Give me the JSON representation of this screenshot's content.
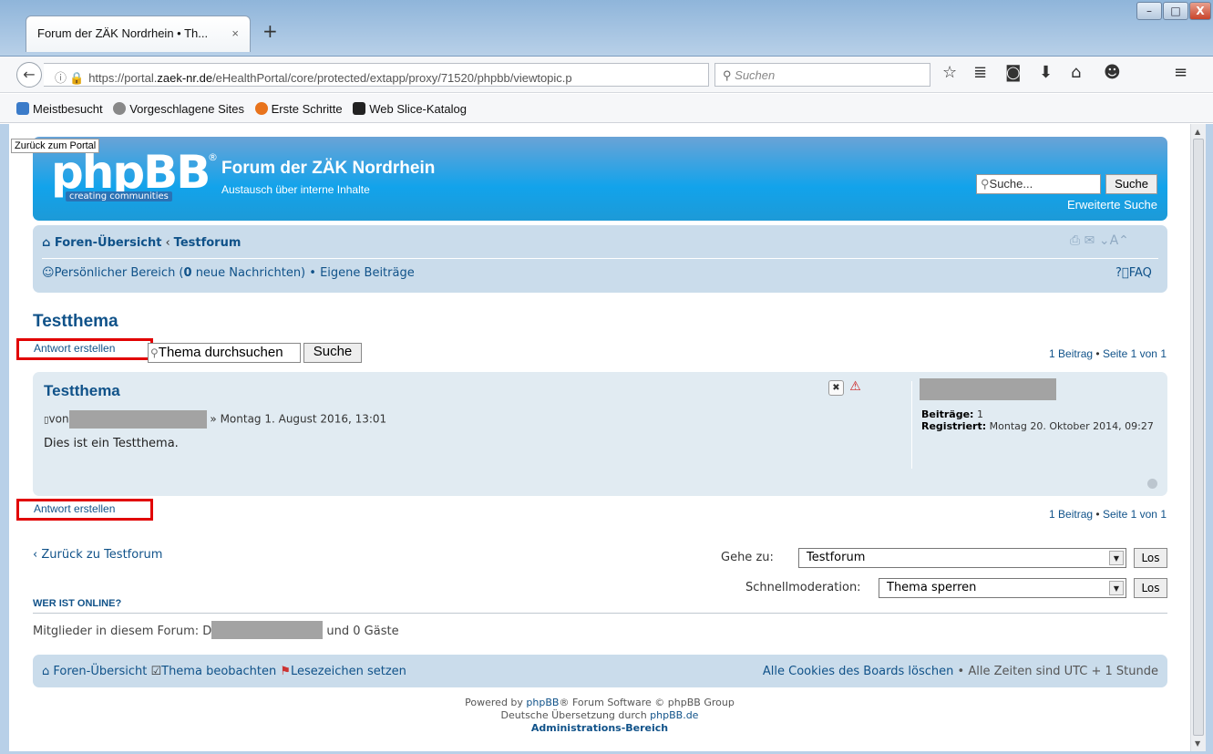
{
  "browser": {
    "tab_title": "Forum der ZÄK Nordrhein • Th...",
    "tab_close": "×",
    "new_tab": "+",
    "win_min": "–",
    "win_max": "□",
    "win_close": "X",
    "url_prefix": "https://portal.",
    "url_domain": "zaek-nr.de",
    "url_path": "/eHealthPortal/core/protected/extapp/proxy/71520/phpbb/viewtopic.p",
    "search_placeholder": "Suchen",
    "toolbar_icons": [
      "star-icon",
      "bookmarks-list-icon",
      "pocket-icon",
      "download-icon",
      "home-icon",
      "chat-icon",
      "menu-icon"
    ],
    "bookmarks": [
      "Meistbesucht",
      "Vorgeschlagene Sites",
      "Erste Schritte",
      "Web Slice-Katalog"
    ]
  },
  "page": {
    "portal_link": "Zurück zum Portal",
    "header": {
      "logo_text": "phpBB",
      "logo_tagline": "creating  communities",
      "title": "Forum der ZÄK Nordrhein",
      "description": "Austausch über interne Inhalte",
      "search_placeholder": "Suche...",
      "search_button": "Suche",
      "advanced_search": "Erweiterte Suche"
    },
    "nav": {
      "home": "Foren-Übersicht",
      "forum": "Testforum",
      "user_area_prefix": "Persönlicher Bereich (",
      "new_messages_count": "0",
      "user_area_suffix": " neue Nachrichten)",
      "own_posts": "Eigene Beiträge",
      "faq": "FAQ"
    },
    "topic": {
      "title": "Testthema",
      "reply_button": "Antwort erstellen",
      "search_placeholder": "Thema durchsuchen",
      "search_button": "Suche",
      "pagination_count": "1 Beitrag",
      "pagination_page": "Seite 1 von 1"
    },
    "post": {
      "title": "Testthema",
      "author_prefix": "von",
      "date": "» Montag 1. August 2016, 13:01",
      "body": "Dies ist ein Testthema.",
      "posts_label": "Beiträge:",
      "posts_value": "1",
      "registered_label": "Registriert:",
      "registered_value": "Montag 20. Oktober 2014, 09:27"
    },
    "bottom": {
      "back_link": "Zurück zu Testforum",
      "jump_label": "Gehe zu:",
      "jump_value": "Testforum",
      "go_button": "Los",
      "mod_label": "Schnellmoderation:",
      "mod_value": "Thema sperren"
    },
    "online": {
      "title": "WER IST ONLINE?",
      "prefix": "Mitglieder in diesem Forum: D",
      "suffix": " und 0 Gäste"
    },
    "footer": {
      "home": "Foren-Übersicht",
      "watch": "Thema beobachten",
      "bookmark": "Lesezeichen setzen",
      "delete_cookies": "Alle Cookies des Boards löschen",
      "timezone": "Alle Zeiten sind UTC + 1 Stunde",
      "powered_prefix": "Powered by ",
      "phpbb_link": "phpBB",
      "powered_suffix": "® Forum Software © phpBB Group",
      "translation_prefix": "Deutsche Übersetzung durch ",
      "translation_link": "phpBB.de",
      "admin": "Administrations-Bereich"
    }
  }
}
